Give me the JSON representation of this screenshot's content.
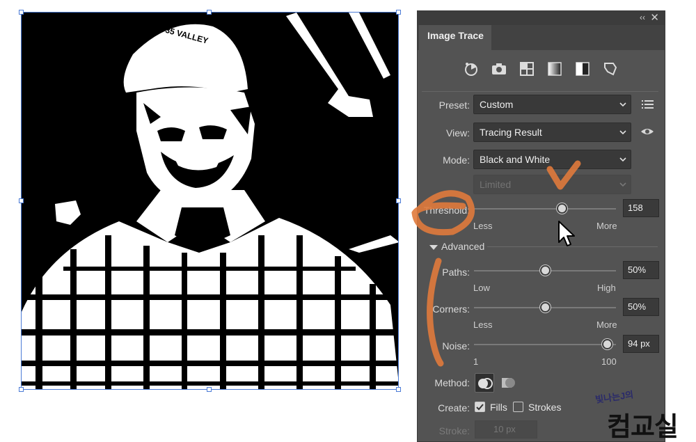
{
  "panel": {
    "collapse_glyph": "‹‹",
    "close_glyph": "✕",
    "tab_title": "Image Trace",
    "preset_icons": [
      "auto-color-icon",
      "high-color-camera-icon",
      "low-color-grid-icon",
      "grayscale-gradient-icon",
      "black-white-half-icon",
      "outline-shape-icon"
    ],
    "preset": {
      "label": "Preset:",
      "value": "Custom"
    },
    "view": {
      "label": "View:",
      "value": "Tracing Result"
    },
    "mode": {
      "label": "Mode:",
      "value": "Black and White"
    },
    "palette": {
      "value": "Limited"
    },
    "threshold": {
      "label": "Threshold:",
      "value": "158",
      "min_label": "Less",
      "max_label": "More",
      "level": 0.62
    },
    "advanced": {
      "label": "Advanced"
    },
    "paths": {
      "label": "Paths:",
      "value": "50%",
      "min_label": "Low",
      "max_label": "High",
      "level": 0.5
    },
    "corners": {
      "label": "Corners:",
      "value": "50%",
      "min_label": "Less",
      "max_label": "More",
      "level": 0.5
    },
    "noise": {
      "label": "Noise:",
      "value": "94 px",
      "min_label": "1",
      "max_label": "100",
      "level": 0.94
    },
    "method": {
      "label": "Method:"
    },
    "create": {
      "label": "Create:",
      "fills_label": "Fills",
      "fills_checked": true,
      "strokes_label": "Strokes",
      "strokes_checked": false
    },
    "stroke": {
      "label": "Stroke:",
      "value": "10 px"
    }
  },
  "watermark": {
    "small_text": "빛나는J의",
    "big_text": "컴교실"
  },
  "colors": {
    "panel_bg": "#535353",
    "annotation": "#e07a3c",
    "selection": "#4b7bd6"
  }
}
